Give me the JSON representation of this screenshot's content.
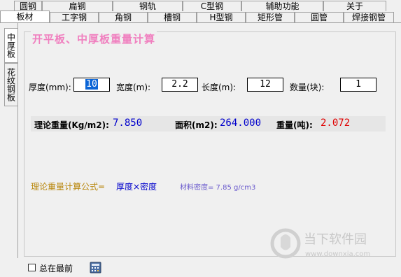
{
  "tabs_row1": [
    "圆钢",
    "扁钢",
    "钢轨",
    "C型钢",
    "辅助功能",
    "关于"
  ],
  "tabs_row2": [
    "板材",
    "工字钢",
    "角钢",
    "槽钢",
    "H型钢",
    "矩形管",
    "圆管",
    "焊接钢管"
  ],
  "vtabs": [
    "中厚板",
    "花纹钢板"
  ],
  "group_title": "开平板、中厚板重量计算",
  "inputs": {
    "thickness_label": "厚度(mm):",
    "thickness_value": "10",
    "width_label": "宽度(m):",
    "width_value": "2.2",
    "length_label": "长度(m):",
    "length_value": "12",
    "count_label": "数量(块):",
    "count_value": "1"
  },
  "results": {
    "theory_label": "理论重量(Kg/m2):",
    "theory_value": "7.850",
    "area_label": "面积(m2):",
    "area_value": "264.000",
    "weight_label": "重量(吨):",
    "weight_value": "2.072"
  },
  "formula": {
    "label": "理论重量计算公式=",
    "expr": "厚度×密度",
    "density": "材料密度= 7.85 g/cm3"
  },
  "footer": {
    "always_on_top": "总在最前"
  },
  "watermark": {
    "cn": "当下软件园",
    "url": "www.downxia.com"
  },
  "colors": {
    "title": "#f07fbf",
    "blue": "#0000cc",
    "red": "#e00000",
    "formula_label": "#b8860b",
    "density": "#6a5acd"
  }
}
